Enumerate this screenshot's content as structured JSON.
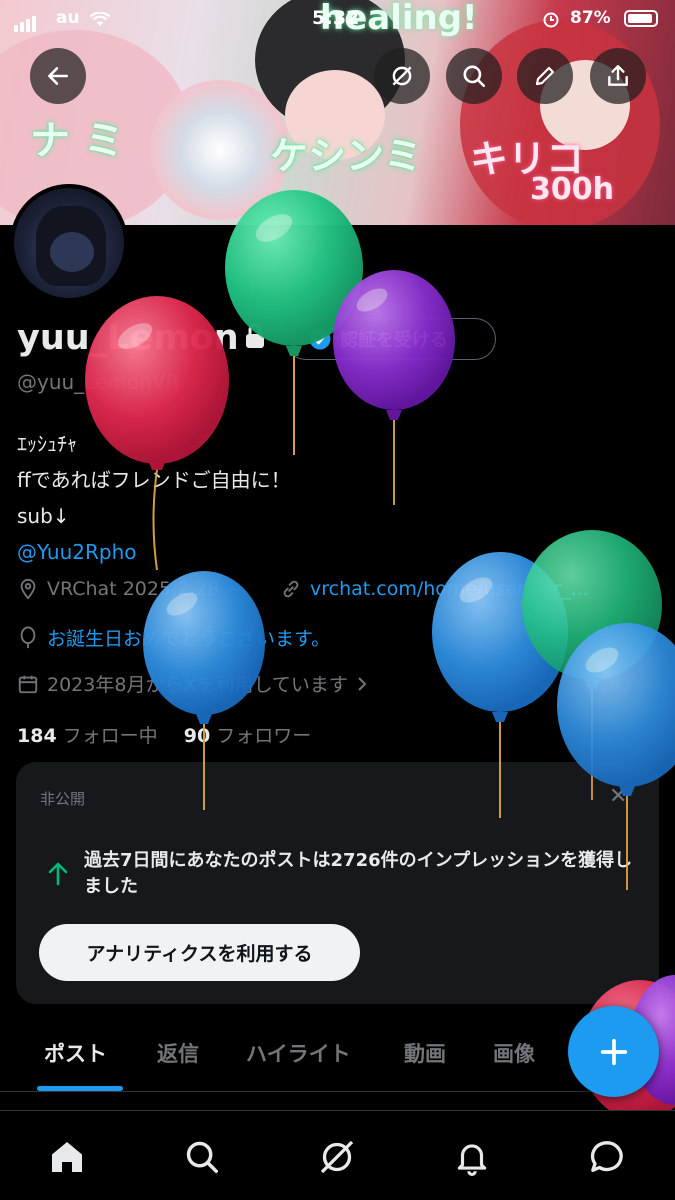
{
  "status_bar": {
    "carrier": "au",
    "time": "5:32",
    "battery": "87%"
  },
  "banner": {
    "art_text": [
      "ナ ミ",
      "ケシンミ",
      "キリコ",
      "300h",
      "healing!"
    ]
  },
  "header_buttons": [
    "back-icon",
    "grok-icon",
    "search-icon",
    "edit-icon",
    "share-icon"
  ],
  "profile": {
    "display_name": "yuu_Lemon",
    "verify_label": "認証を受ける",
    "handle": "@yuu_LemonVR",
    "bio_lines": [
      "ｴｯｼｭﾁｬ",
      "ffであればフレンドご自由に！",
      "sub↓"
    ],
    "bio_link": "@Yuu2Rpho",
    "location": "VRChat 2025.2.28 ~",
    "website": "vrchat.com/home/user/usr_...",
    "birthday": "お誕生日おめでとうございます。",
    "joined": "2023年8月からXを利用しています",
    "following_count": "184",
    "following_label": "フォロー中",
    "followers_count": "90",
    "followers_label": "フォロワー"
  },
  "private_card": {
    "label": "非公開",
    "close": "✕",
    "text": "過去7日間にあなたのポストは2726件のインプレッションを獲得しました",
    "button": "アナリティクスを利用する"
  },
  "tabs": [
    {
      "label": "ポスト",
      "active": true
    },
    {
      "label": "返信",
      "active": false
    },
    {
      "label": "ハイライト",
      "active": false
    },
    {
      "label": "動画",
      "active": false
    },
    {
      "label": "画像",
      "active": false
    }
  ],
  "bottom_nav": [
    "home-icon",
    "search-icon",
    "grok-icon",
    "notifications-icon",
    "messages-icon"
  ],
  "colors": {
    "accent": "#1d9bf0",
    "background": "#000000",
    "card": "#16181c",
    "muted": "#71767b",
    "balloon_red": "#e0294f",
    "balloon_green": "#2ecc8a",
    "balloon_purple": "#8a2fd0",
    "balloon_blue": "#2f8fe0"
  }
}
